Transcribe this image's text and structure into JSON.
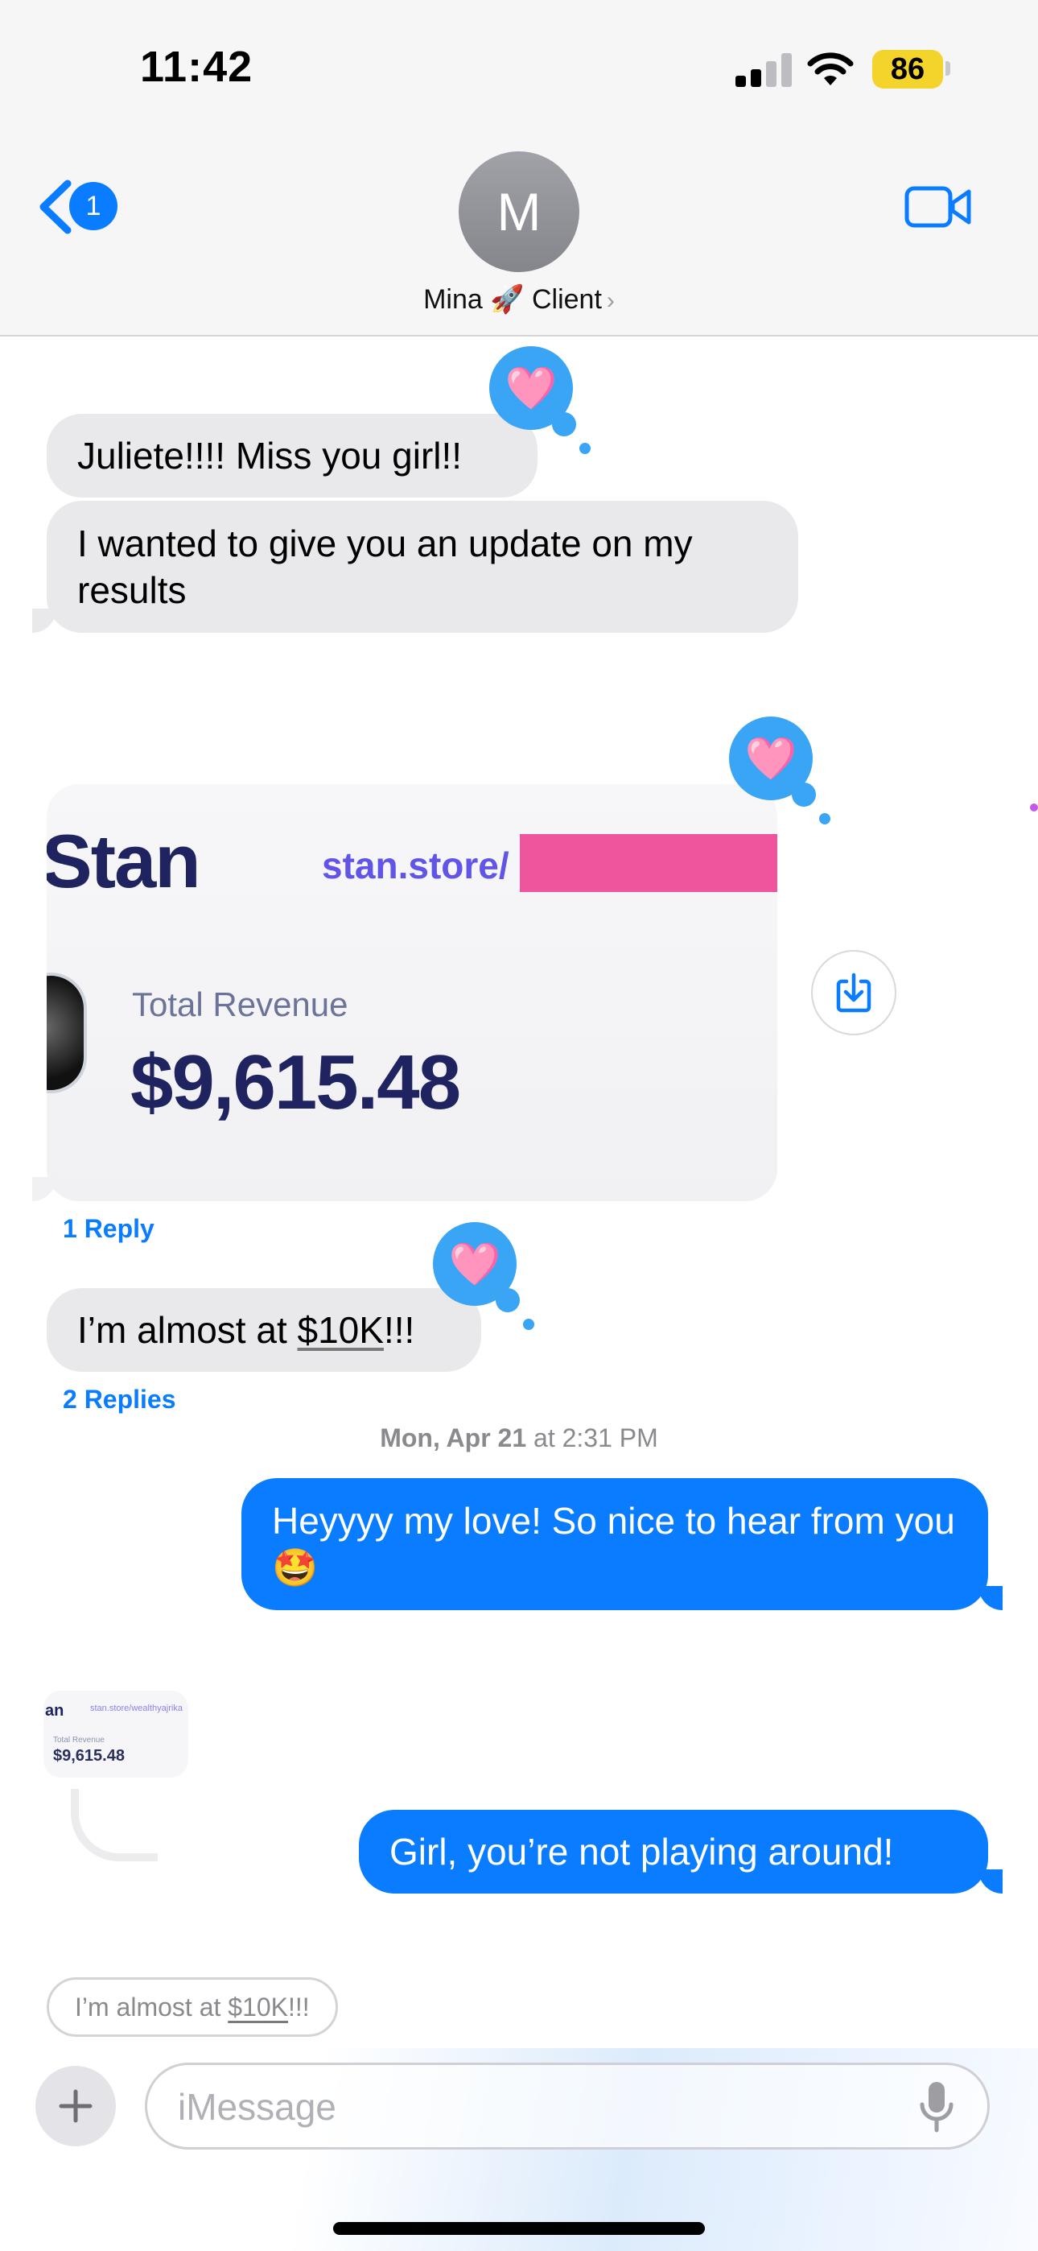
{
  "status_bar": {
    "time": "11:42",
    "battery": "86"
  },
  "header": {
    "back_badge": "1",
    "avatar_initial": "M",
    "contact_name": "Mina 🚀 Client",
    "chevron": "›"
  },
  "messages": {
    "m1": "Juliete!!!! Miss you girl!!",
    "m2": "I wanted to give you an update on my results",
    "screenshot": {
      "logo": "Stan",
      "url": "stan.store/",
      "label": "Total Revenue",
      "value": "$9,615.48"
    },
    "reply_count_1": "1 Reply",
    "m3_prefix": "I’m almost at ",
    "m3_link": "$10K",
    "m3_suffix": "!!!",
    "reply_count_2": "2 Replies",
    "timestamp_day": "Mon, Apr 21",
    "timestamp_time": " at 2:31 PM",
    "m4": "Heyyyy my love! So nice to hear from you 🤩",
    "thumb": {
      "logo": "an",
      "url": "stan.store/wealthyajrika",
      "label": "Total Revenue",
      "value": "$9,615.48"
    },
    "m5": "Girl, you’re not playing around!",
    "reply_context_prefix": "I’m almost at ",
    "reply_context_link": "$10K",
    "reply_context_suffix": "!!!"
  },
  "reactions": {
    "heart": "🩷"
  },
  "composer": {
    "placeholder": "iMessage"
  },
  "colors": {
    "accent": "#0a7cff",
    "incoming": "#e9e9eb",
    "tapback": "#3aa4f5",
    "redaction": "#ee559d"
  }
}
